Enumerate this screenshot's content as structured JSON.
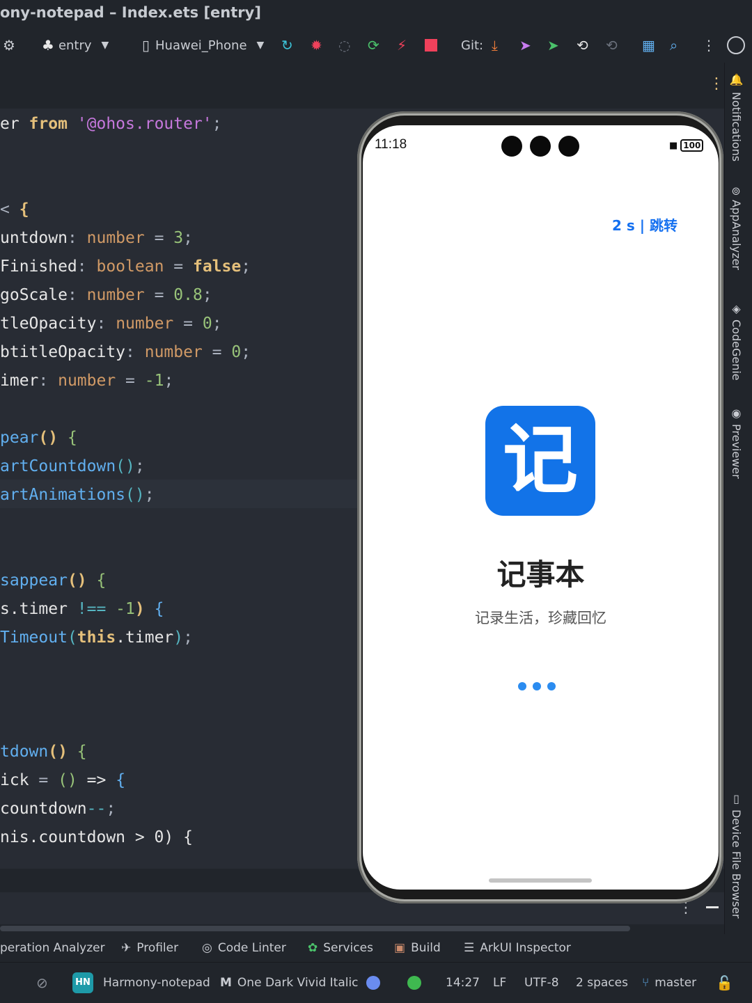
{
  "window": {
    "title": "ony-notepad – Index.ets [entry]"
  },
  "toolbar": {
    "module": "entry",
    "device": "Huawei_Phone",
    "git_label": "Git:"
  },
  "code_lines": [
    [
      {
        "t": "er ",
        "c": "id"
      },
      {
        "t": "from ",
        "c": "kw"
      },
      {
        "t": "'@ohos.router'",
        "c": "str"
      },
      {
        "t": ";",
        "c": "pn"
      }
    ],
    [],
    [],
    [
      {
        "t": "< ",
        "c": "pn"
      },
      {
        "t": "{",
        "c": "kw"
      }
    ],
    [
      {
        "t": "untdown",
        "c": "id"
      },
      {
        "t": ": ",
        "c": "pn"
      },
      {
        "t": "number",
        "c": "kw2"
      },
      {
        "t": " = ",
        "c": "pn"
      },
      {
        "t": "3",
        "c": "num"
      },
      {
        "t": ";",
        "c": "pn"
      }
    ],
    [
      {
        "t": "Finished",
        "c": "id"
      },
      {
        "t": ": ",
        "c": "pn"
      },
      {
        "t": "boolean",
        "c": "kw2"
      },
      {
        "t": " = ",
        "c": "pn"
      },
      {
        "t": "false",
        "c": "kw"
      },
      {
        "t": ";",
        "c": "pn"
      }
    ],
    [
      {
        "t": "goScale",
        "c": "id"
      },
      {
        "t": ": ",
        "c": "pn"
      },
      {
        "t": "number",
        "c": "kw2"
      },
      {
        "t": " = ",
        "c": "pn"
      },
      {
        "t": "0.8",
        "c": "num"
      },
      {
        "t": ";",
        "c": "pn"
      }
    ],
    [
      {
        "t": "tleOpacity",
        "c": "id"
      },
      {
        "t": ": ",
        "c": "pn"
      },
      {
        "t": "number",
        "c": "kw2"
      },
      {
        "t": " = ",
        "c": "pn"
      },
      {
        "t": "0",
        "c": "num"
      },
      {
        "t": ";",
        "c": "pn"
      }
    ],
    [
      {
        "t": "btitleOpacity",
        "c": "id"
      },
      {
        "t": ": ",
        "c": "pn"
      },
      {
        "t": "number",
        "c": "kw2"
      },
      {
        "t": " = ",
        "c": "pn"
      },
      {
        "t": "0",
        "c": "num"
      },
      {
        "t": ";",
        "c": "pn"
      }
    ],
    [
      {
        "t": "imer",
        "c": "id"
      },
      {
        "t": ": ",
        "c": "pn"
      },
      {
        "t": "number",
        "c": "kw2"
      },
      {
        "t": " = ",
        "c": "pn"
      },
      {
        "t": "-1",
        "c": "num"
      },
      {
        "t": ";",
        "c": "pn"
      }
    ],
    [],
    [
      {
        "t": "pear",
        "c": "fn"
      },
      {
        "t": "() ",
        "c": "kw"
      },
      {
        "t": "{",
        "c": "br"
      }
    ],
    [
      {
        "t": "artCountdown",
        "c": "fn"
      },
      {
        "t": "()",
        "c": "op"
      },
      {
        "t": ";",
        "c": "pn"
      }
    ],
    [
      {
        "t": "artAnimations",
        "c": "fn"
      },
      {
        "t": "()",
        "c": "op"
      },
      {
        "t": ";",
        "c": "pn"
      }
    ],
    [],
    [],
    [
      {
        "t": "sappear",
        "c": "fn"
      },
      {
        "t": "() ",
        "c": "kw"
      },
      {
        "t": "{",
        "c": "br"
      }
    ],
    [
      {
        "t": "s.timer ",
        "c": "id"
      },
      {
        "t": "!== ",
        "c": "op"
      },
      {
        "t": "-1",
        "c": "num"
      },
      {
        "t": ") ",
        "c": "kw"
      },
      {
        "t": "{",
        "c": "bluebr"
      }
    ],
    [
      {
        "t": "Timeout",
        "c": "fn"
      },
      {
        "t": "(",
        "c": "op"
      },
      {
        "t": "this",
        "c": "kw"
      },
      {
        "t": ".timer",
        "c": "id"
      },
      {
        "t": ")",
        "c": "op"
      },
      {
        "t": ";",
        "c": "pn"
      }
    ],
    [],
    [],
    [],
    [
      {
        "t": "tdown",
        "c": "fn"
      },
      {
        "t": "() ",
        "c": "kw"
      },
      {
        "t": "{",
        "c": "br"
      }
    ],
    [
      {
        "t": "ick ",
        "c": "id"
      },
      {
        "t": "= ",
        "c": "pn"
      },
      {
        "t": "() ",
        "c": "br"
      },
      {
        "t": "=> ",
        "c": "id"
      },
      {
        "t": "{",
        "c": "bluebr"
      }
    ],
    [
      {
        "t": "countdown",
        "c": "id"
      },
      {
        "t": "--",
        "c": "op"
      },
      {
        "t": ";",
        "c": "pn"
      }
    ],
    [
      {
        "t": "nis.countdown > 0) {",
        "c": "id"
      }
    ]
  ],
  "right_tools": [
    "Notifications",
    "AppAnalyzer",
    "CodeGenie",
    "Previewer",
    "Device File Browser"
  ],
  "phone": {
    "time": "11:18",
    "battery": "100",
    "skip_label": "2 s | 跳转",
    "app_logo_char": "记",
    "app_title": "记事本",
    "app_subtitle": "记录生活，珍藏回忆"
  },
  "tool_windows": [
    "peration Analyzer",
    "Profiler",
    "Code Linter",
    "Services",
    "Build",
    "ArkUI Inspector"
  ],
  "status": {
    "project_badge": "HN",
    "project": "Harmony-notepad",
    "theme": "One Dark Vivid Italic",
    "position": "14:27",
    "line_sep": "LF",
    "encoding": "UTF-8",
    "indent": "2 spaces",
    "branch": "master"
  }
}
